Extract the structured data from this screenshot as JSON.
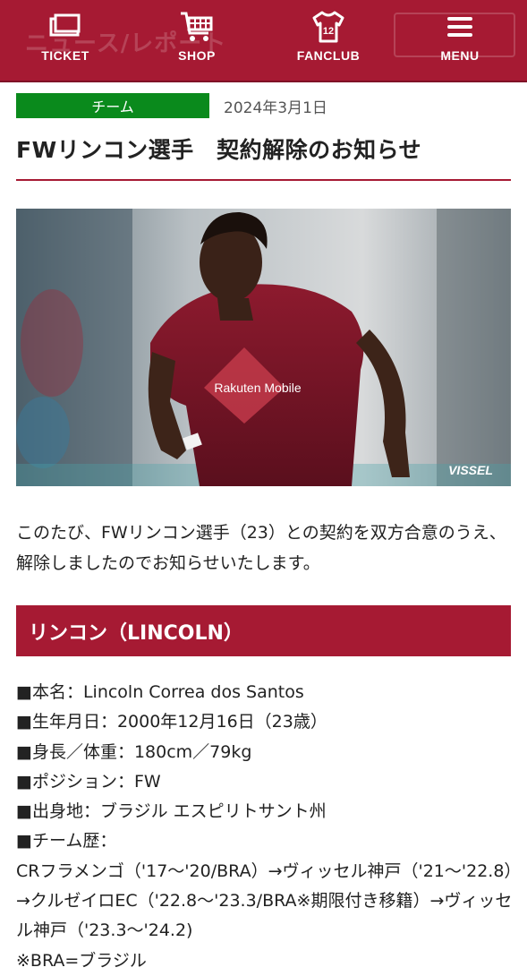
{
  "nav": {
    "ghost_text": "ニュース/レポート",
    "items": [
      {
        "label": "TICKET",
        "icon": "ticket-icon"
      },
      {
        "label": "SHOP",
        "icon": "cart-icon"
      },
      {
        "label": "FANCLUB",
        "icon": "jersey-icon"
      },
      {
        "label": "MENU",
        "icon": "hamburger-icon"
      }
    ],
    "fanclub_number": "12"
  },
  "article": {
    "category": "チーム",
    "date": "2024年3月1日",
    "title": "FWリンコン選手　契約解除のお知らせ",
    "photo_watermark": "VISSEL",
    "lead": "このたび、FWリンコン選手（23）との契約を双方合意のうえ、解除しましたのでお知らせいたします。",
    "section_title": "リンコン（LINCOLN）",
    "profile": {
      "name": "■本名：Lincoln Correa dos Santos",
      "birthday": "■生年月日：2000年12月16日（23歳）",
      "size": "■身長／体重：180cm／79kg",
      "position": "■ポジション：FW",
      "birthplace": "■出身地：ブラジル エスピリトサント州",
      "history_label": "■チーム歴：",
      "history": "CRフラメンゴ（'17～'20/BRA）→ヴィッセル神戸（'21～'22.8）→クルゼイロEC（'22.8～'23.3/BRA※期限付き移籍）→ヴィッセル神戸（'23.3～'24.2)",
      "note": "※BRA=ブラジル"
    }
  },
  "colors": {
    "brand": "#a61a33",
    "category": "#0a8a1c"
  }
}
